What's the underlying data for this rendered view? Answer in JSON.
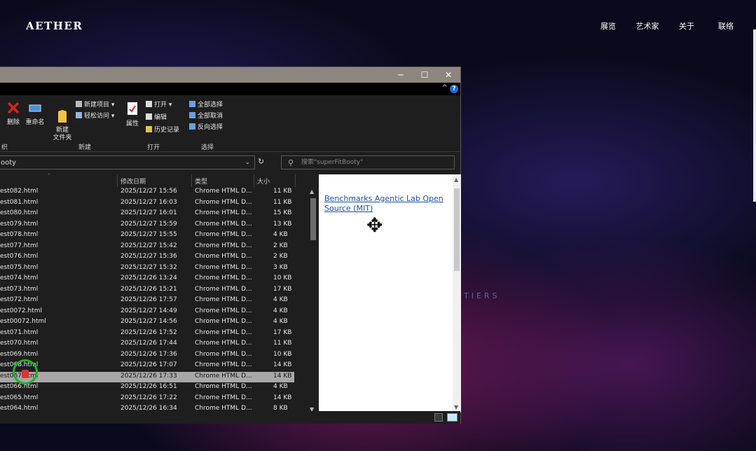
{
  "site": {
    "logo": "AETHER",
    "nav": [
      "展览",
      "艺术家",
      "关于",
      "联络"
    ],
    "bg_text": "TIERS"
  },
  "window": {
    "controls": [
      "─",
      "☐",
      "✕"
    ],
    "ribbon": {
      "delete": "删除",
      "rename": "重命名",
      "new_folder": "新建\n文件夹",
      "new_item": "新建项目 ▾",
      "easy_access": "轻松访问 ▾",
      "properties": "属性",
      "open": "打开 ▾",
      "edit": "编辑",
      "history": "历史记录",
      "select_all": "全部选择",
      "select_none": "全部取消",
      "invert": "反向选择",
      "groups": [
        "织",
        "新建",
        "打开",
        "选择"
      ]
    },
    "address": "ooty",
    "search_placeholder": "搜索\"superFitBooty\"",
    "columns": [
      "修改日期",
      "类型",
      "大小"
    ],
    "files": [
      {
        "name": "est082.html",
        "date": "2025/12/27 15:56",
        "type": "Chrome HTML D...",
        "size": "11 KB"
      },
      {
        "name": "est081.html",
        "date": "2025/12/27 16:03",
        "type": "Chrome HTML D...",
        "size": "11 KB"
      },
      {
        "name": "est080.html",
        "date": "2025/12/27 16:01",
        "type": "Chrome HTML D...",
        "size": "15 KB"
      },
      {
        "name": "est079.html",
        "date": "2025/12/27 15:59",
        "type": "Chrome HTML D...",
        "size": "13 KB"
      },
      {
        "name": "est078.html",
        "date": "2025/12/27 15:55",
        "type": "Chrome HTML D...",
        "size": "4 KB"
      },
      {
        "name": "est077.html",
        "date": "2025/12/27 15:42",
        "type": "Chrome HTML D...",
        "size": "2 KB"
      },
      {
        "name": "est076.html",
        "date": "2025/12/27 15:36",
        "type": "Chrome HTML D...",
        "size": "2 KB"
      },
      {
        "name": "est075.html",
        "date": "2025/12/27 15:32",
        "type": "Chrome HTML D...",
        "size": "3 KB"
      },
      {
        "name": "est074.html",
        "date": "2025/12/26 13:24",
        "type": "Chrome HTML D...",
        "size": "10 KB"
      },
      {
        "name": "est073.html",
        "date": "2025/12/26 15:21",
        "type": "Chrome HTML D...",
        "size": "17 KB"
      },
      {
        "name": "est072.html",
        "date": "2025/12/26 17:57",
        "type": "Chrome HTML D...",
        "size": "4 KB"
      },
      {
        "name": "est0072.html",
        "date": "2025/12/27 14:49",
        "type": "Chrome HTML D...",
        "size": "4 KB"
      },
      {
        "name": "est00072.html",
        "date": "2025/12/27 14:56",
        "type": "Chrome HTML D...",
        "size": "4 KB"
      },
      {
        "name": "est071.html",
        "date": "2025/12/26 17:52",
        "type": "Chrome HTML D...",
        "size": "17 KB"
      },
      {
        "name": "est070.html",
        "date": "2025/12/26 17:44",
        "type": "Chrome HTML D...",
        "size": "11 KB"
      },
      {
        "name": "est069.html",
        "date": "2025/12/26 17:36",
        "type": "Chrome HTML D...",
        "size": "10 KB"
      },
      {
        "name": "est068.html",
        "date": "2025/12/26 17:07",
        "type": "Chrome HTML D...",
        "size": "14 KB"
      },
      {
        "name": "est067.html",
        "date": "2025/12/26 17:33",
        "type": "Chrome HTML D...",
        "size": "14 KB"
      },
      {
        "name": "est066.html",
        "date": "2025/12/26 16:51",
        "type": "Chrome HTML D...",
        "size": "4 KB"
      },
      {
        "name": "est065.html",
        "date": "2025/12/26 17:22",
        "type": "Chrome HTML D...",
        "size": "14 KB"
      },
      {
        "name": "est064.html",
        "date": "2025/12/26 16:34",
        "type": "Chrome HTML D...",
        "size": "8 KB"
      }
    ],
    "preview_text": "Benchmarks Agentic Lab Open Source (MIT)"
  }
}
